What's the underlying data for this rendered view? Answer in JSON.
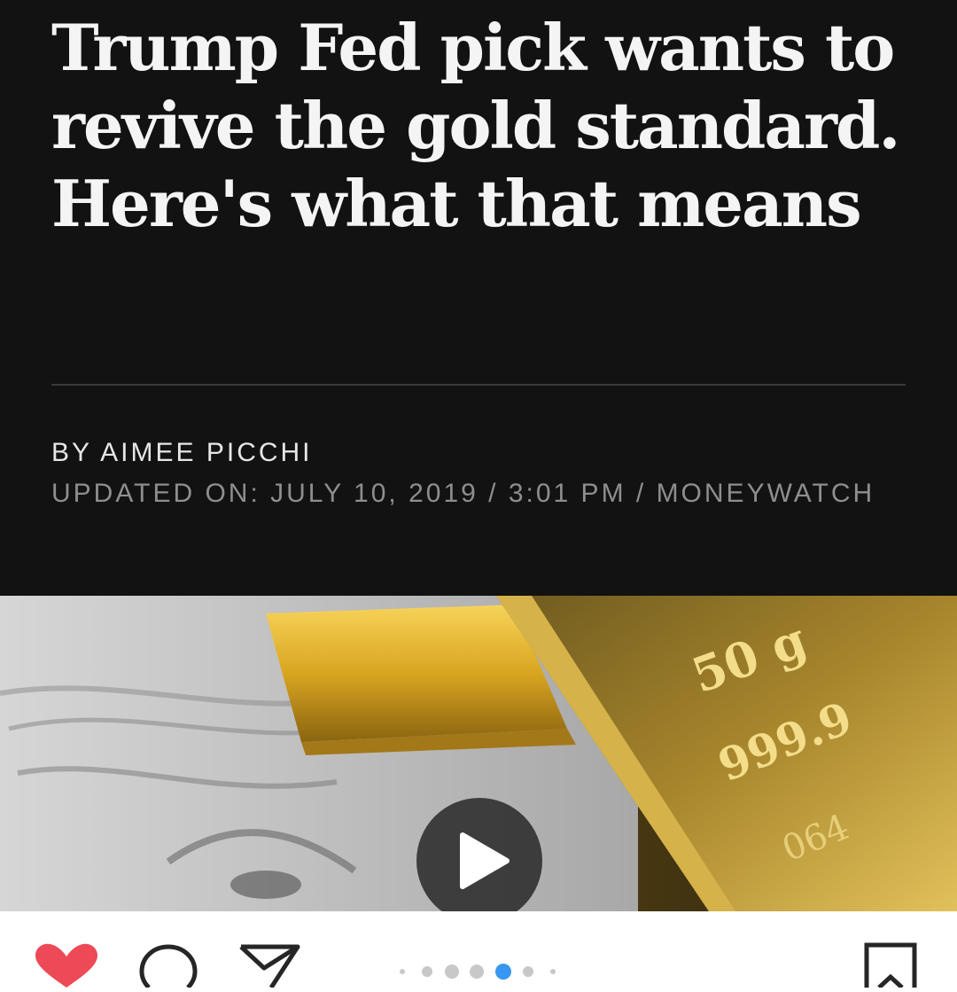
{
  "article": {
    "headline": "Trump Fed pick wants to revive the gold standard. Here's what that means",
    "byline": "BY AIMEE PICCHI",
    "meta": "UPDATED ON: JULY 10, 2019 / 3:01 PM / MONEYWATCH"
  },
  "media": {
    "bar_text_1": "50 g",
    "bar_text_2": "999.9",
    "bar_text_3": "064"
  },
  "carousel": {
    "total_dots": 7,
    "active_index": 4,
    "active_color": "#3897f0",
    "inactive_color": "#c8c8c8"
  },
  "icons": {
    "like": "heart-icon",
    "comment": "comment-icon",
    "share": "send-icon",
    "save": "bookmark-icon",
    "play": "play-icon"
  },
  "colors": {
    "header_bg": "#121212",
    "headline": "#f4f4f4",
    "meta_text": "#8e8e8e",
    "like_red": "#ed4956"
  }
}
